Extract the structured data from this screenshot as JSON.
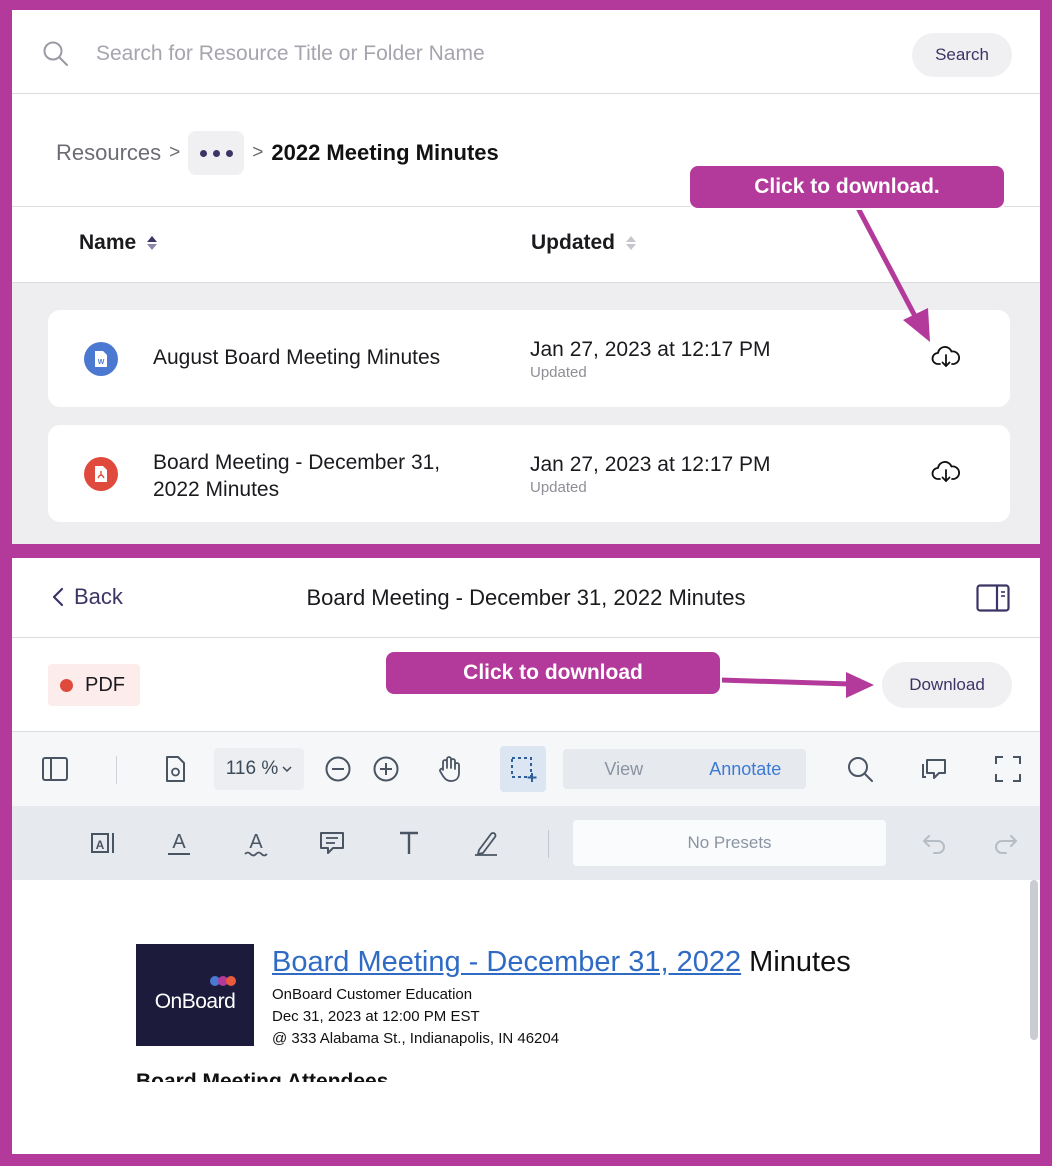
{
  "search": {
    "placeholder": "Search for Resource Title or Folder Name",
    "button_label": "Search"
  },
  "breadcrumb": {
    "root": "Resources",
    "separator": ">",
    "current": "2022 Meeting Minutes"
  },
  "table": {
    "columns": [
      "Name",
      "Updated"
    ],
    "rows": [
      {
        "name": "August Board Meeting Minutes",
        "type": "word",
        "date": "Jan 27, 2023 at 12:17 PM",
        "sub": "Updated"
      },
      {
        "name": "Board Meeting - December 31, 2022 Minutes",
        "type": "pdf",
        "date": "Jan 27, 2023 at 12:17 PM",
        "sub": "Updated"
      }
    ]
  },
  "viewer": {
    "back_label": "Back",
    "title": "Board Meeting - December 31, 2022 Minutes",
    "file_type": "PDF",
    "download_label": "Download"
  },
  "toolbar": {
    "zoom": "116 %",
    "mode_view": "View",
    "mode_annotate": "Annotate",
    "presets": "No Presets"
  },
  "document": {
    "logo_text": "OnBoard",
    "heading_link": "Board Meeting - December 31, 2022",
    "heading_rest": " Minutes",
    "line1": "OnBoard Customer Education",
    "line2": "Dec 31, 2023 at 12:00 PM EST",
    "line3": "@ 333 Alabama St., Indianapolis, IN 46204",
    "section_peek": "Board Meeting Attendees"
  },
  "callouts": {
    "top": "Click to download.",
    "bottom": "Click to download"
  },
  "colors": {
    "frame": "#b33a9a",
    "accent": "#3b3566",
    "word": "#4b78d0",
    "pdf": "#e04a3d",
    "link": "#2f6bc4",
    "annotate": "#3c7ad6"
  }
}
